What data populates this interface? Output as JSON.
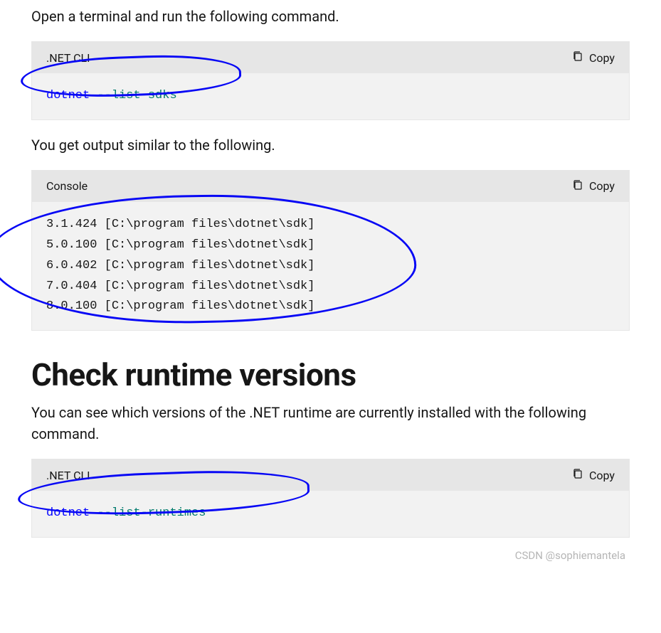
{
  "paragraphs": {
    "p1": "Open a terminal and run the following command.",
    "p2": "You get output similar to the following.",
    "p3": "You can see which versions of the .NET runtime are currently installed with the following command."
  },
  "heading": "Check runtime versions",
  "copy_label": "Copy",
  "blocks": {
    "b1": {
      "lang": ".NET CLI",
      "kw": "dotnet",
      "fn": "--list-sdks"
    },
    "b2": {
      "lang": "Console",
      "output": "3.1.424 [C:\\program files\\dotnet\\sdk]\n5.0.100 [C:\\program files\\dotnet\\sdk]\n6.0.402 [C:\\program files\\dotnet\\sdk]\n7.0.404 [C:\\program files\\dotnet\\sdk]\n8.0.100 [C:\\program files\\dotnet\\sdk]"
    },
    "b3": {
      "lang": ".NET CLI",
      "kw": "dotnet",
      "fn": "--list-runtimes"
    }
  },
  "watermark": "CSDN @sophiemantela"
}
